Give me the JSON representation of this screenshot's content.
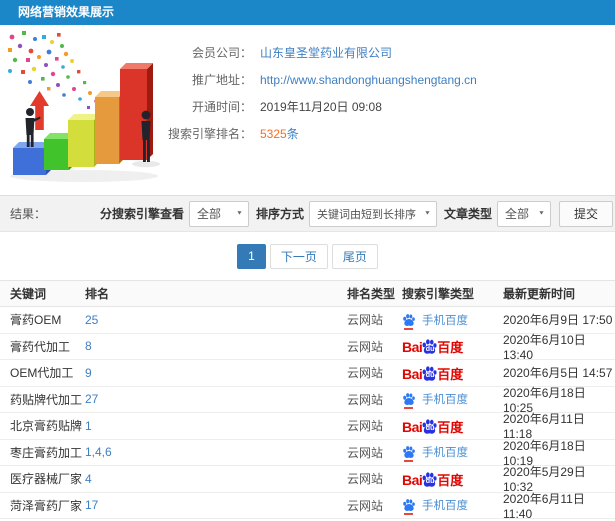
{
  "header": {
    "title": "网络营销效果展示"
  },
  "info": {
    "company": {
      "label": "会员公司：",
      "value": "山东皇圣堂药业有限公司"
    },
    "promo_url": {
      "label": "推广地址：",
      "value": "http://www.shandonghuangshengtang.cn"
    },
    "open_time": {
      "label": "开通时间：",
      "value": "2019年11月20日 09:08"
    },
    "engine_rank": {
      "label": "搜索引擎排名：",
      "value": "5325",
      "unit": "条"
    }
  },
  "filters": {
    "result_label": "结果：",
    "engine_view": {
      "label": "分搜索引擎查看",
      "value": "全部"
    },
    "sort": {
      "label": "排序方式",
      "value": "关键词由短到长排序"
    },
    "article_type": {
      "label": "文章类型",
      "value": "全部"
    },
    "submit_label": "提交",
    "caret": "▼"
  },
  "pagination": {
    "current": "1",
    "next_label": "下一页",
    "last_label": "尾页"
  },
  "table": {
    "headers": [
      "关键词",
      "排名",
      "排名类型",
      "搜索引擎类型",
      "最新更新时间"
    ],
    "baidu_logo": {
      "bai": "Bai",
      "du": "du",
      "name": "百度"
    },
    "rows": [
      {
        "keyword": "膏药OEM",
        "rank": "25",
        "rank_type": "云网站",
        "engine": "mobile-baidu",
        "engine_label": "手机百度",
        "time": "2020年6月9日 17:50"
      },
      {
        "keyword": "膏药代加工",
        "rank": "8",
        "rank_type": "云网站",
        "engine": "baidu",
        "engine_label": "百度",
        "time": "2020年6月10日 13:40"
      },
      {
        "keyword": "OEM代加工",
        "rank": "9",
        "rank_type": "云网站",
        "engine": "baidu",
        "engine_label": "百度",
        "time": "2020年6月5日 14:57"
      },
      {
        "keyword": "药贴牌代加工",
        "rank": "27",
        "rank_type": "云网站",
        "engine": "mobile-baidu",
        "engine_label": "手机百度",
        "time": "2020年6月18日 10:25"
      },
      {
        "keyword": "北京膏药贴牌",
        "rank": "1",
        "rank_type": "云网站",
        "engine": "baidu",
        "engine_label": "百度",
        "time": "2020年6月11日 11:18"
      },
      {
        "keyword": "枣庄膏药加工",
        "rank": "1,4,6",
        "rank_type": "云网站",
        "engine": "mobile-baidu",
        "engine_label": "手机百度",
        "time": "2020年6月18日 10:19"
      },
      {
        "keyword": "医疗器械厂家",
        "rank": "4",
        "rank_type": "云网站",
        "engine": "baidu",
        "engine_label": "百度",
        "time": "2020年5月29日 10:32"
      },
      {
        "keyword": "菏泽膏药厂家",
        "rank": "17",
        "rank_type": "云网站",
        "engine": "mobile-baidu",
        "engine_label": "手机百度",
        "time": "2020年6月11日 11:40"
      }
    ]
  },
  "colors": {
    "topbar_blue": "#1b86c8",
    "link_blue": "#3e7fc1",
    "highlight_orange": "#ff6a1c",
    "pagination_blue": "#337ab7",
    "baidu_red": "#e10601",
    "baidu_paw_blue": "#2932e1",
    "mobile_paw_blue": "#2d78f4"
  }
}
